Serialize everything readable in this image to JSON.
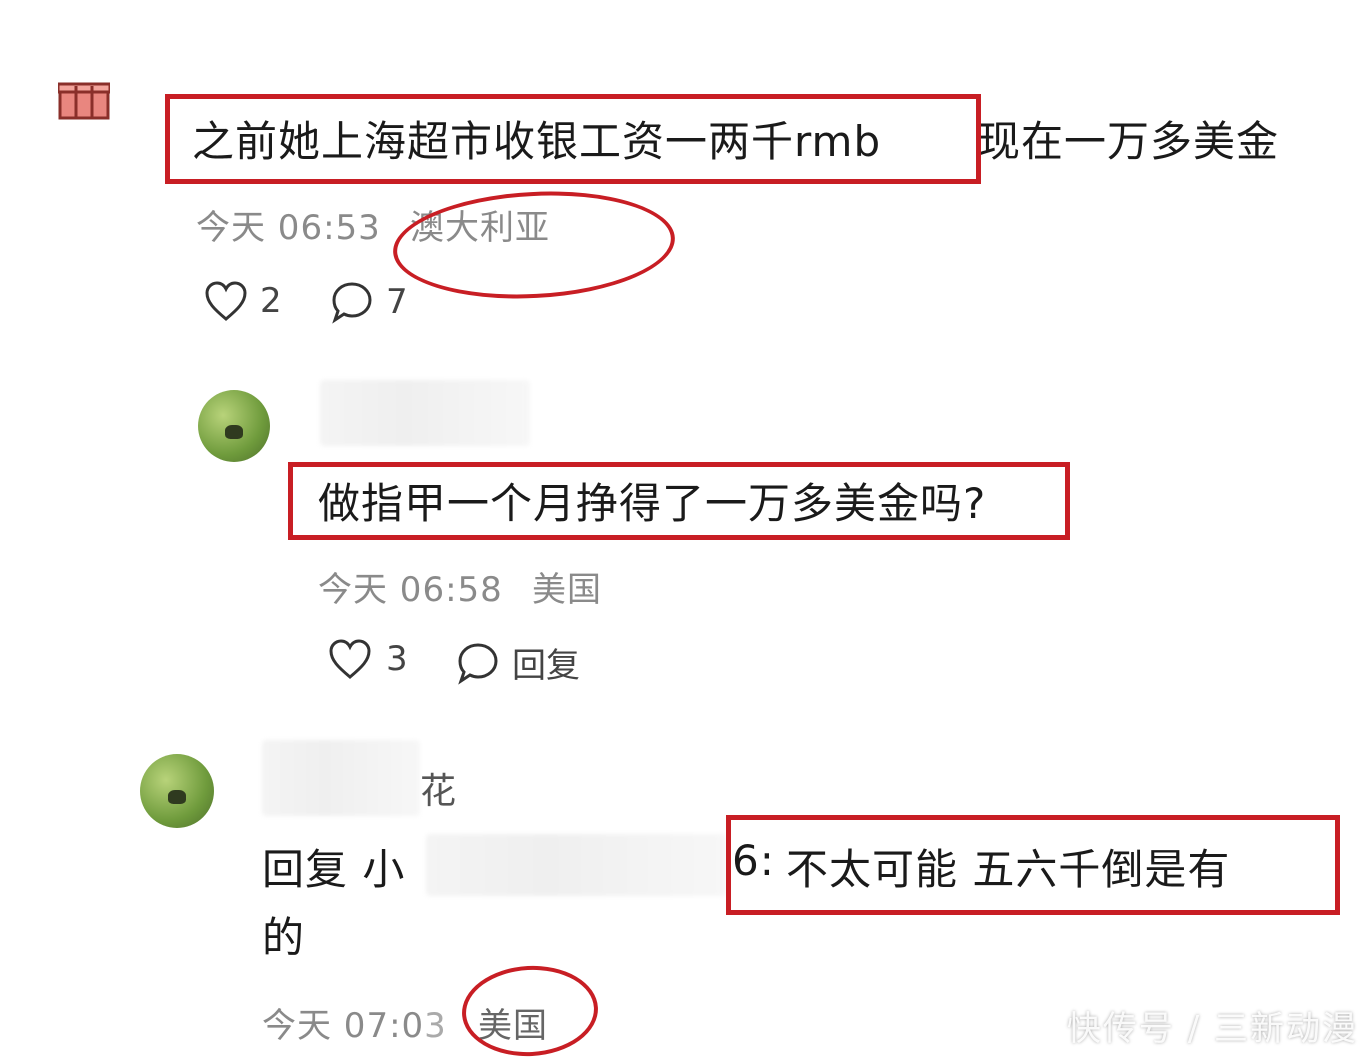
{
  "comment": {
    "text_highlighted": "之前她上海超市收银工资一两千rmb",
    "text_rest": "现在一万多美金",
    "time": "今天 06:53",
    "location": "澳大利亚",
    "likes": "2",
    "replies": "7"
  },
  "reply1": {
    "text": "做指甲一个月挣得了一万多美金吗?",
    "time": "今天 06:58",
    "location": "美国",
    "likes": "3",
    "reply_label": "回复"
  },
  "reply2": {
    "username_suffix": "花",
    "reply_prefix": "回复 小",
    "reply_target_tail": "6:",
    "text_highlighted": "不太可能 五六千倒是有",
    "text_wrap": "的",
    "time": "今天 07:0",
    "time_tail": "3",
    "location": "美国"
  },
  "watermark": "快传号 / 三新动漫",
  "colors": {
    "highlight": "#c81e24",
    "meta": "#8a8a8a"
  }
}
